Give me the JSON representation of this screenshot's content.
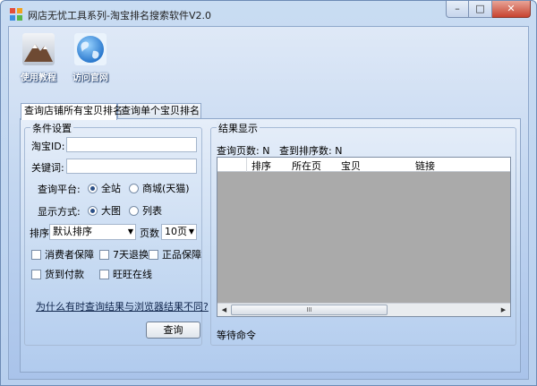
{
  "window": {
    "title": "网店无忧工具系列-淘宝排名搜索软件V2.0",
    "controls": {
      "minimize": "–",
      "maximize": "□",
      "close": "✕"
    }
  },
  "toolbar": {
    "tutorial_label": "使用教程",
    "website_label": "访问官网"
  },
  "tabs": [
    {
      "label": "查询店铺所有宝贝排名",
      "active": true
    },
    {
      "label": "查询单个宝贝排名",
      "active": false
    }
  ],
  "conditions": {
    "group_title": "条件设置",
    "taobao_id_label": "淘宝ID:",
    "taobao_id_value": "",
    "keyword_label": "关键词:",
    "keyword_value": "",
    "platform_label": "查询平台:",
    "platform_options": [
      "全站",
      "商城(天猫)"
    ],
    "platform_selected": "全站",
    "display_label": "显示方式:",
    "display_options": [
      "大图",
      "列表"
    ],
    "display_selected": "大图",
    "sort_label": "排序",
    "sort_value": "默认排序",
    "pages_label": "页数",
    "pages_value": "10页",
    "filters": [
      "消费者保障",
      "7天退换",
      "正品保障",
      "货到付款",
      "旺旺在线"
    ],
    "help_link": "为什么有时查询结果与浏览器结果不同?",
    "query_button": "查询"
  },
  "results": {
    "group_title": "结果显示",
    "pages_queried": "查询页数: N",
    "rank_found": "查到排序数: N",
    "columns": [
      "排序",
      "所在页",
      "宝贝",
      "链接"
    ],
    "rows": [],
    "scroll_thumb": "III",
    "status": "等待命令"
  },
  "colors": {
    "grid_empty": "#aaaaaa",
    "close_button": "#c7432f",
    "window_frame": "#b7cfee"
  }
}
